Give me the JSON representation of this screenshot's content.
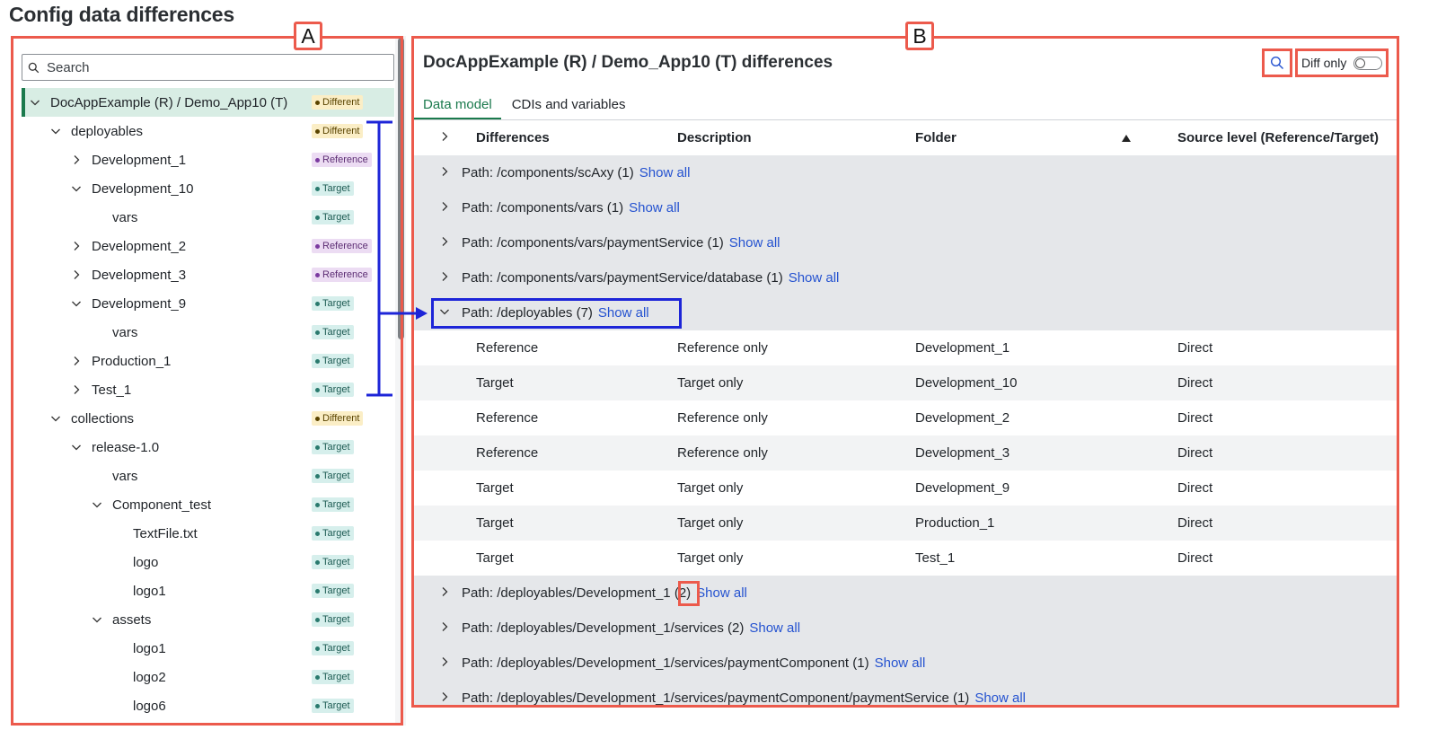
{
  "page_title": "Config data differences",
  "labels": {
    "a": "A",
    "b": "B"
  },
  "search": {
    "placeholder": "Search"
  },
  "tree": [
    {
      "label": "DocAppExample (R) / Demo_App10 (T)",
      "level": 0,
      "state": "expanded",
      "badge": "Different",
      "kind": "different",
      "selected": true
    },
    {
      "label": "deployables",
      "level": 1,
      "state": "expanded",
      "badge": "Different",
      "kind": "different"
    },
    {
      "label": "Development_1",
      "level": 2,
      "state": "collapsed",
      "badge": "Reference",
      "kind": "reference"
    },
    {
      "label": "Development_10",
      "level": 2,
      "state": "expanded",
      "badge": "Target",
      "kind": "target"
    },
    {
      "label": "vars",
      "level": 3,
      "state": "leaf",
      "badge": "Target",
      "kind": "target"
    },
    {
      "label": "Development_2",
      "level": 2,
      "state": "collapsed",
      "badge": "Reference",
      "kind": "reference"
    },
    {
      "label": "Development_3",
      "level": 2,
      "state": "collapsed",
      "badge": "Reference",
      "kind": "reference"
    },
    {
      "label": "Development_9",
      "level": 2,
      "state": "expanded",
      "badge": "Target",
      "kind": "target"
    },
    {
      "label": "vars",
      "level": 3,
      "state": "leaf",
      "badge": "Target",
      "kind": "target"
    },
    {
      "label": "Production_1",
      "level": 2,
      "state": "collapsed",
      "badge": "Target",
      "kind": "target"
    },
    {
      "label": "Test_1",
      "level": 2,
      "state": "collapsed",
      "badge": "Target",
      "kind": "target"
    },
    {
      "label": "collections",
      "level": 1,
      "state": "expanded",
      "badge": "Different",
      "kind": "different"
    },
    {
      "label": "release-1.0",
      "level": 2,
      "state": "expanded",
      "badge": "Target",
      "kind": "target"
    },
    {
      "label": "vars",
      "level": 3,
      "state": "leaf",
      "badge": "Target",
      "kind": "target"
    },
    {
      "label": "Component_test",
      "level": 3,
      "state": "expanded",
      "badge": "Target",
      "kind": "target"
    },
    {
      "label": "TextFile.txt",
      "level": 4,
      "state": "leaf",
      "badge": "Target",
      "kind": "target"
    },
    {
      "label": "logo",
      "level": 4,
      "state": "leaf",
      "badge": "Target",
      "kind": "target"
    },
    {
      "label": "logo1",
      "level": 4,
      "state": "leaf",
      "badge": "Target",
      "kind": "target"
    },
    {
      "label": "assets",
      "level": 3,
      "state": "expanded",
      "badge": "Target",
      "kind": "target"
    },
    {
      "label": "logo1",
      "level": 4,
      "state": "leaf",
      "badge": "Target",
      "kind": "target"
    },
    {
      "label": "logo2",
      "level": 4,
      "state": "leaf",
      "badge": "Target",
      "kind": "target"
    },
    {
      "label": "logo6",
      "level": 4,
      "state": "leaf",
      "badge": "Target",
      "kind": "target"
    }
  ],
  "right": {
    "title": "DocAppExample (R) / Demo_App10 (T) differences",
    "diff_only_label": "Diff only",
    "diff_only_on": false,
    "tabs": [
      {
        "label": "Data model",
        "active": true
      },
      {
        "label": "CDIs and variables",
        "active": false
      }
    ],
    "columns": {
      "differences": "Differences",
      "description": "Description",
      "folder": "Folder",
      "source_level": "Source level (Reference/Target)"
    },
    "show_all_label": "Show all",
    "rows": [
      {
        "type": "group",
        "text": "Path: /components/scAxy (1)",
        "expanded": false
      },
      {
        "type": "group",
        "text": "Path: /components/vars (1)",
        "expanded": false
      },
      {
        "type": "group",
        "text": "Path: /components/vars/paymentService (1)",
        "expanded": false
      },
      {
        "type": "group",
        "text": "Path: /components/vars/paymentService/database (1)",
        "expanded": false
      },
      {
        "type": "group",
        "text": "Path: /deployables (7)",
        "expanded": true
      },
      {
        "type": "child",
        "difference": "Reference",
        "description": "Reference only",
        "folder": "Development_1",
        "source": "Direct"
      },
      {
        "type": "child",
        "difference": "Target",
        "description": "Target only",
        "folder": "Development_10",
        "source": "Direct"
      },
      {
        "type": "child",
        "difference": "Reference",
        "description": "Reference only",
        "folder": "Development_2",
        "source": "Direct"
      },
      {
        "type": "child",
        "difference": "Reference",
        "description": "Reference only",
        "folder": "Development_3",
        "source": "Direct"
      },
      {
        "type": "child",
        "difference": "Target",
        "description": "Target only",
        "folder": "Development_9",
        "source": "Direct"
      },
      {
        "type": "child",
        "difference": "Target",
        "description": "Target only",
        "folder": "Production_1",
        "source": "Direct"
      },
      {
        "type": "child",
        "difference": "Target",
        "description": "Target only",
        "folder": "Test_1",
        "source": "Direct"
      },
      {
        "type": "group",
        "text": "Path: /deployables/Development_1 (2)",
        "expanded": false
      },
      {
        "type": "group",
        "text": "Path: /deployables/Development_1/services (2)",
        "expanded": false
      },
      {
        "type": "group",
        "text": "Path: /deployables/Development_1/services/paymentComponent (1)",
        "expanded": false
      },
      {
        "type": "group",
        "text": "Path: /deployables/Development_1/services/paymentComponent/paymentService (1)",
        "expanded": false
      }
    ]
  },
  "colors": {
    "annotation_red": "#ec5a4c",
    "annotation_blue": "#1d25d8",
    "accent_green": "#1b7a4d",
    "link_blue": "#2452d0"
  }
}
